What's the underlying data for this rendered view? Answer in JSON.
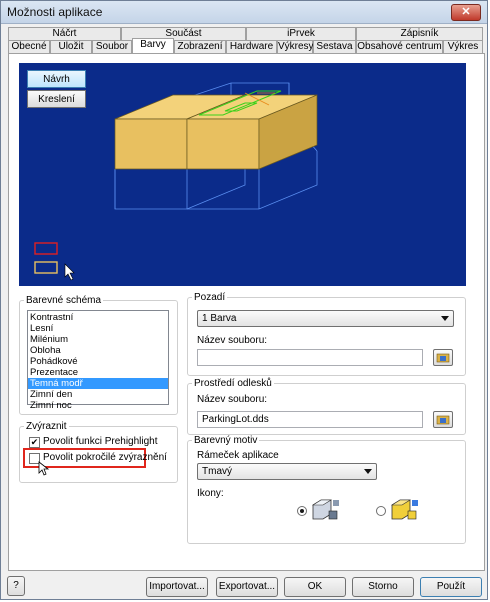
{
  "window": {
    "title": "Možnosti aplikace",
    "close": "✕"
  },
  "tabs_top": [
    "Náčrt",
    "Součást",
    "iPrvek",
    "Zápisník"
  ],
  "tabs_bottom": [
    "Obecné",
    "Uložit",
    "Soubor",
    "Barvy",
    "Zobrazení",
    "Hardware",
    "Výkresy",
    "Sestava",
    "Obsahové centrum",
    "Výkres"
  ],
  "selected_tab": "Barvy",
  "preview": {
    "buttons": [
      "Návrh",
      "Kreslení"
    ],
    "active_button": "Návrh",
    "background_color": "#0b2b8a"
  },
  "color_scheme": {
    "legend": "Barevné schéma",
    "items": [
      "Kontrastní",
      "Lesní",
      "Milénium",
      "Obloha",
      "Pohádkové",
      "Prezentace",
      "Temná modř",
      "Zimní den",
      "Zimní noc"
    ],
    "selected": "Temná modř"
  },
  "background": {
    "legend": "Pozadí",
    "combo_value": "1 Barva",
    "file_label": "Název souboru:",
    "file_value": ""
  },
  "reflection": {
    "legend": "Prostředí odlesků",
    "file_label": "Název souboru:",
    "file_value": "ParkingLot.dds"
  },
  "highlight": {
    "legend": "Zvýraznit",
    "prehighlight_label": "Povolit funkci Prehighlight",
    "prehighlight_checked": true,
    "enhanced_label": "Povolit pokročilé zvýraznění",
    "enhanced_checked": false
  },
  "color_theme": {
    "legend": "Barevný motiv",
    "frame_label": "Rámeček aplikace",
    "frame_value": "Tmavý",
    "icons_label": "Ikony:",
    "icon_option_selected": 0
  },
  "footer": {
    "help": "?",
    "import": "Importovat...",
    "export": "Exportovat...",
    "ok": "OK",
    "cancel": "Storno",
    "apply": "Použít"
  },
  "colors": {
    "accent_red": "#e0261c",
    "list_selection": "#3399ff",
    "cube_yellow": "#e8c060"
  }
}
